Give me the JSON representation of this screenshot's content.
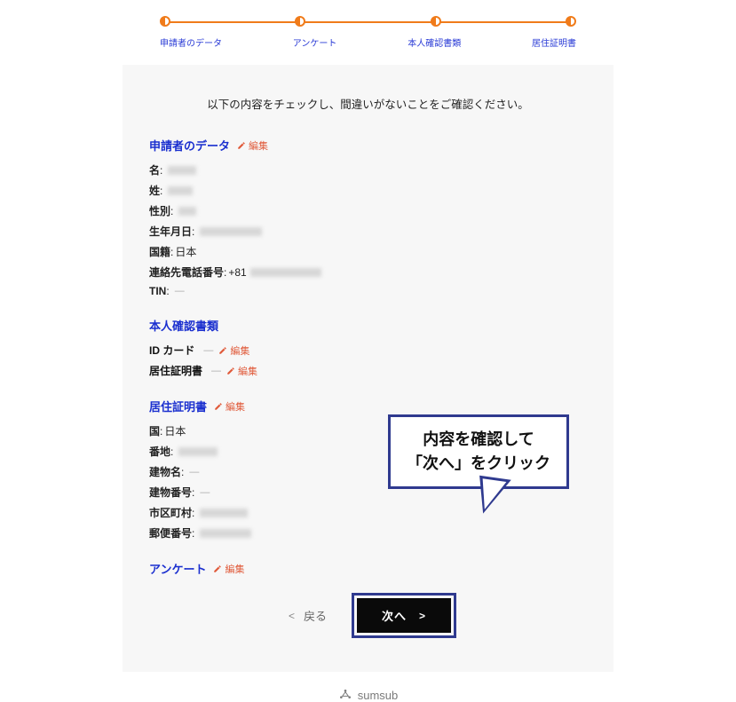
{
  "stepper": {
    "steps": [
      {
        "label": "申請者のデータ"
      },
      {
        "label": "アンケート"
      },
      {
        "label": "本人確認書類"
      },
      {
        "label": "居住証明書"
      }
    ]
  },
  "intro": "以下の内容をチェックし、間違いがないことをご確認ください。",
  "edit_label": "編集",
  "sections": {
    "applicant": {
      "title": "申請者のデータ",
      "fields": {
        "name_label": "名",
        "surname_label": "姓",
        "gender_label": "性別",
        "dob_label": "生年月日",
        "nationality_label": "国籍",
        "nationality_value": "日本",
        "phone_label": "連絡先電話番号",
        "phone_prefix": "+81",
        "tin_label": "TIN",
        "tin_value": "—"
      }
    },
    "identity": {
      "title": "本人確認書類",
      "id_card_label": "ID カード",
      "residence_proof_label": "居住証明書"
    },
    "residence": {
      "title": "居住証明書",
      "fields": {
        "country_label": "国",
        "country_value": "日本",
        "street_label": "番地",
        "building_name_label": "建物名",
        "building_no_label": "建物番号",
        "city_label": "市区町村",
        "postal_label": "郵便番号"
      }
    },
    "survey": {
      "title": "アンケート"
    }
  },
  "callout": {
    "line1": "内容を確認して",
    "line2": "「次へ」をクリック"
  },
  "buttons": {
    "back": "戻る",
    "next": "次へ"
  },
  "footer": {
    "brand": "sumsub"
  }
}
